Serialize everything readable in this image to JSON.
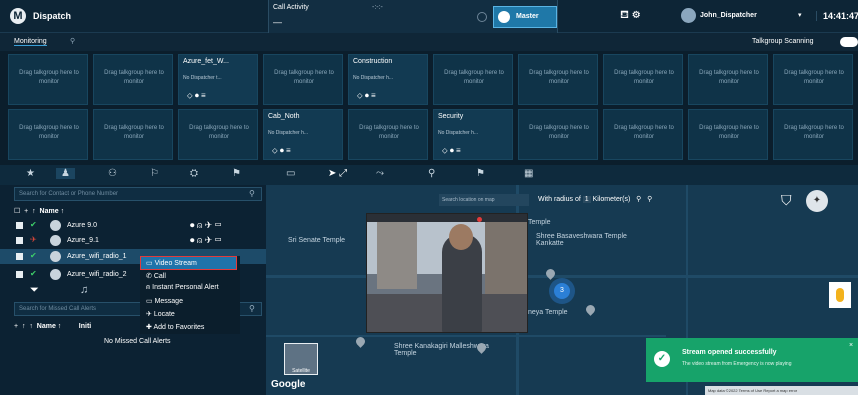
{
  "app": {
    "logo": "M",
    "title": "Dispatch"
  },
  "call_activity": {
    "title": "Call Activity",
    "status": "-:-:-",
    "who": "—",
    "master_label": "Master"
  },
  "header": {
    "user_name": "John_Dispatcher",
    "chevron": "▾",
    "clock": "14:41:47",
    "icons": "⛾  ⚙"
  },
  "monitoring": {
    "label": "Monitoring",
    "pin": "⚲",
    "scanning_label": "Talkgroup Scanning"
  },
  "slots": [
    {
      "drag": "Drag talkgroup here to monitor"
    },
    {
      "drag": "Drag talkgroup here to monitor"
    },
    {
      "name": "Azure_fet_W...",
      "sub": "No Dispatcher t...",
      "controls": "⬦  ⏺  ≡"
    },
    {
      "drag": "Drag talkgroup here to monitor"
    },
    {
      "name": "Construction",
      "sub": "No Dispatcher h...",
      "controls": "⬦  ⏺  ≡"
    },
    {
      "drag": "Drag talkgroup here to monitor"
    },
    {
      "drag": "Drag talkgroup here to monitor"
    },
    {
      "drag": "Drag talkgroup here to monitor"
    },
    {
      "drag": "Drag talkgroup here to monitor"
    },
    {
      "drag": "Drag talkgroup here to monitor"
    },
    {
      "drag": "Drag talkgroup here to monitor"
    },
    {
      "drag": "Drag talkgroup here to monitor"
    },
    {
      "drag": "Drag talkgroup here to monitor"
    },
    {
      "name": "Cab_Noth",
      "sub": "No Dispatcher h...",
      "controls": "⬦  ⏺  ≡"
    },
    {
      "drag": "Drag talkgroup here to monitor"
    },
    {
      "name": "Security",
      "sub": "No Dispatcher h...",
      "controls": "⬦  ⏺  ≡"
    },
    {
      "drag": "Drag talkgroup here to monitor"
    },
    {
      "drag": "Drag talkgroup here to monitor"
    },
    {
      "drag": "Drag talkgroup here to monitor"
    },
    {
      "drag": "Drag talkgroup here to monitor"
    }
  ],
  "contacts": {
    "search_placeholder": "Search for Contact or Phone Number",
    "name_header": "Name",
    "rows": [
      {
        "name": "Azure 9.0",
        "icons": "⏺ ⍝ ✈ ▭"
      },
      {
        "name": "Azure_9.1",
        "icons": "⏺ ⍝ ✈ ▭"
      },
      {
        "name": "Azure_wifi_radio_1",
        "icons": ""
      },
      {
        "name": "Azure_wifi_radio_2",
        "icons": ""
      }
    ]
  },
  "context_menu": [
    "Video Stream",
    "Call",
    "Instant Personal Alert",
    "Message",
    "Locate",
    "Add to Favorites"
  ],
  "missed_calls": {
    "search_placeholder": "Search for Missed Call Alerts",
    "name_header": "Name",
    "init_header": "Initi",
    "empty": "No Missed Call Alerts"
  },
  "map": {
    "search_placeholder": "Search location on map",
    "radius_label": "With radius of",
    "radius_value": "1",
    "radius_unit": "Kilometer(s)",
    "labels": [
      "Sri Senate Temple",
      "Shree Basaveshwara Temple Kankatte",
      "Temple",
      "neya Temple",
      "Shree Kanakagiri Malleshwara Temple"
    ],
    "cluster_count": "3",
    "google": "Google",
    "satellite": "Satellite",
    "footer": "Map data ©2022  Terms of Use  Report a map error"
  },
  "toast": {
    "title": "Stream opened successfully",
    "body": "The video stream from Emergency is now playing",
    "close": "×"
  }
}
